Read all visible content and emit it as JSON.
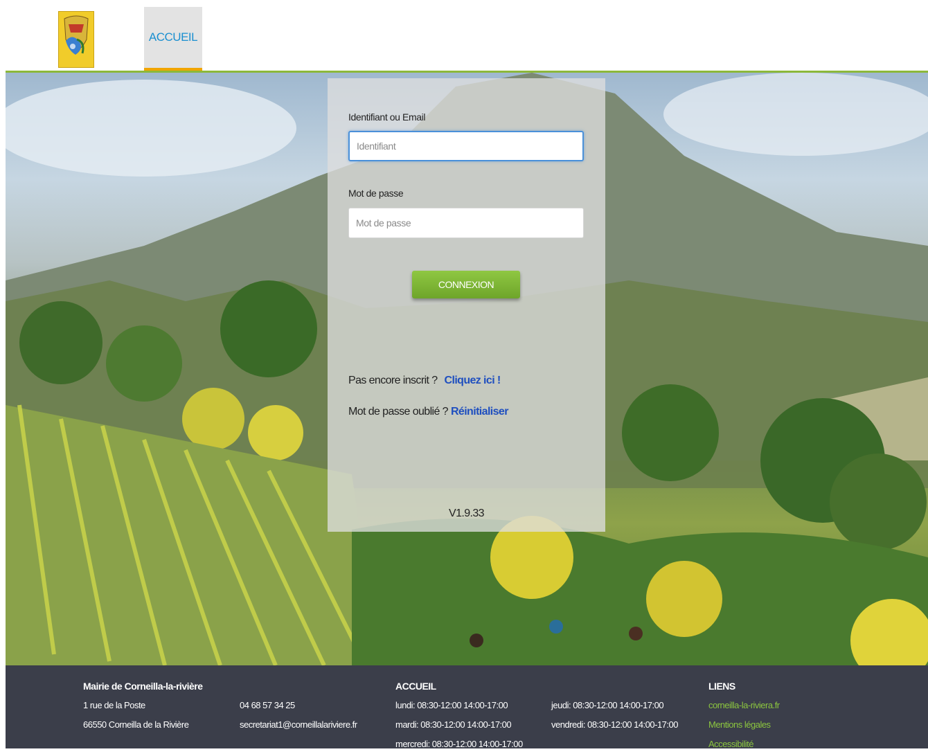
{
  "header": {
    "logo_icon": "coat-of-arms-icon",
    "nav_home_label": "ACCUEIL",
    "accent_color": "#8cb83a",
    "tab_underline_color": "#f0a500"
  },
  "login": {
    "identifier_label": "Identifiant ou Email",
    "identifier_placeholder": "Identifiant",
    "identifier_value": "",
    "password_label": "Mot de passe",
    "password_placeholder": "Mot de passe",
    "password_value": "",
    "submit_label": "CONNEXION",
    "register_prompt": "Pas encore inscrit ?",
    "register_link": "Cliquez ici !",
    "forgot_prompt": "Mot de passe oublié ?",
    "forgot_link": "Réinitialiser",
    "version": "V1.9.33",
    "button_color": "#7db536",
    "link_color": "#1f4fbf"
  },
  "footer": {
    "org_name": "Mairie de Corneilla-la-rivière",
    "address_line1": "1 rue de la Poste",
    "address_line2": "66550 Corneilla de la Rivière",
    "phone": "04 68 57 34 25",
    "email": "secretariat1@corneillalariviere.fr",
    "hours_title": "ACCUEIL",
    "hours_col1": [
      "lundi: 08:30-12:00 14:00-17:00",
      "mardi: 08:30-12:00 14:00-17:00",
      "mercredi: 08:30-12:00 14:00-17:00"
    ],
    "hours_col2": [
      "jeudi: 08:30-12:00 14:00-17:00",
      "vendredi: 08:30-12:00 14:00-17:00"
    ],
    "links_title": "LIENS",
    "links": [
      "corneilla-la-riviera.fr",
      "Mentions légales",
      "Accessibilité"
    ],
    "background_color": "#3b3e4a",
    "link_color": "#8cc63f"
  }
}
